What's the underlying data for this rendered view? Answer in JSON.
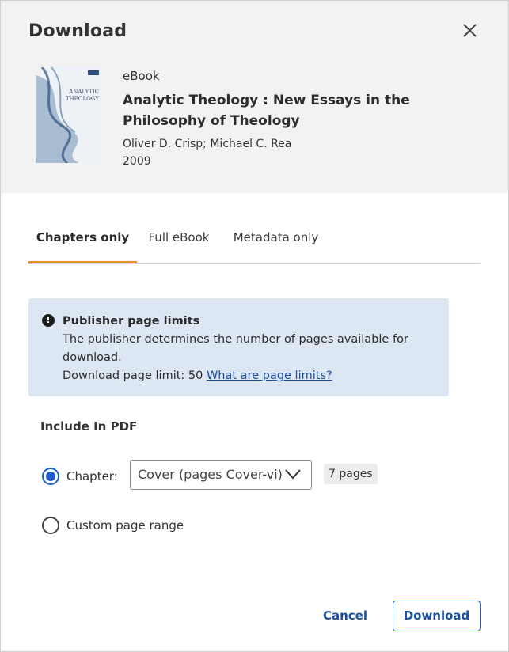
{
  "dialog": {
    "title": "Download",
    "close_icon": "close-icon"
  },
  "book": {
    "cover_title_line1": "ANALYTIC",
    "cover_title_line2": "THEOLOGY",
    "format": "eBook",
    "title": "Analytic Theology : New Essays in the Philosophy of Theology",
    "authors": "Oliver D. Crisp; Michael C. Rea",
    "year": "2009"
  },
  "tabs": [
    {
      "label": "Chapters only",
      "active": true
    },
    {
      "label": "Full eBook",
      "active": false
    },
    {
      "label": "Metadata only",
      "active": false
    }
  ],
  "notice": {
    "icon": "alert-circle-icon",
    "heading": "Publisher page limits",
    "body": "The publisher determines the number of pages available for download.",
    "limit_text": "Download page limit: 50",
    "link_text": "What are page limits?"
  },
  "include": {
    "label": "Include In PDF",
    "chapter_option": "Chapter:",
    "chapter_select_value": "Cover (pages Cover-vi)",
    "pages_badge": "7 pages",
    "custom_option": "Custom page range"
  },
  "footer": {
    "cancel_label": "Cancel",
    "download_label": "Download"
  },
  "colors": {
    "accent": "#1f5fc4",
    "tab_indicator": "#e0921b",
    "notice_bg": "#dde7f4",
    "header_bg": "#f2f2f2"
  }
}
